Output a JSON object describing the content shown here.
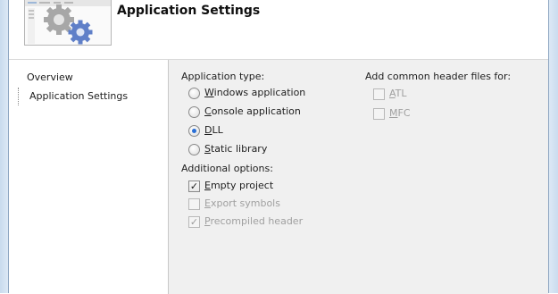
{
  "header": {
    "title": "Application Settings",
    "image_icon": "gears-icon"
  },
  "nav": {
    "items": [
      {
        "label": "Overview",
        "selected": false
      },
      {
        "label": "Application Settings",
        "selected": true
      }
    ]
  },
  "application_type": {
    "label": "Application type:",
    "options": [
      {
        "mn": "W",
        "rest": "indows application",
        "checked": false
      },
      {
        "mn": "C",
        "rest": "onsole application",
        "checked": false
      },
      {
        "mn": "D",
        "rest": "LL",
        "checked": true
      },
      {
        "mn": "S",
        "rest": "tatic library",
        "checked": false
      }
    ]
  },
  "additional_options": {
    "label": "Additional options:",
    "options": [
      {
        "mn": "E",
        "rest": "mpty project",
        "checked": true,
        "enabled": true
      },
      {
        "mn": "E",
        "rest": "xport symbols",
        "checked": false,
        "enabled": false
      },
      {
        "mn": "P",
        "rest": "recompiled header",
        "checked": true,
        "enabled": false
      }
    ]
  },
  "common_headers": {
    "label": "Add common header files for:",
    "options": [
      {
        "mn": "A",
        "rest": "TL",
        "checked": false,
        "enabled": false
      },
      {
        "mn": "M",
        "rest": "FC",
        "checked": false,
        "enabled": false
      }
    ]
  },
  "colors": {
    "radio_dot": "#2a6fd6",
    "panel_bg": "#f0f0f0",
    "frame": "#c9dbee"
  }
}
